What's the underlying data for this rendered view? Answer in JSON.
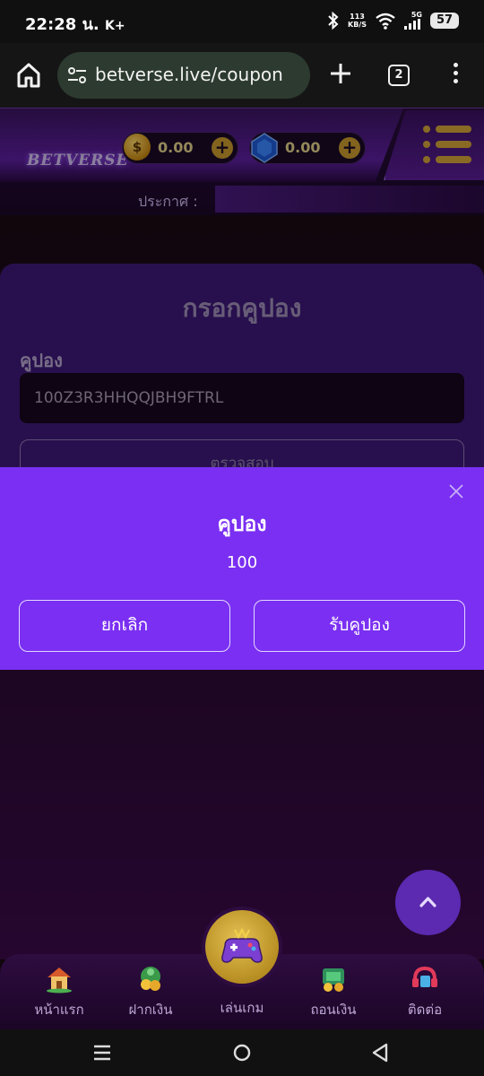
{
  "status_bar": {
    "time": "22:28 น.",
    "carrier_icon": "K+",
    "net_speed_value": "113",
    "net_speed_unit": "KB/S",
    "network": "5G",
    "battery": "57"
  },
  "browser": {
    "url": "betverse.live/coupon",
    "tab_count": "2"
  },
  "site_header": {
    "logo_text": "BETVERSE",
    "coin_balance": "0.00",
    "gem_balance": "0.00",
    "announcement_label": "ประกาศ :"
  },
  "coupon_form": {
    "title": "กรอกคูปอง",
    "field_label": "คูปอง",
    "field_value": "100Z3R3HHQQJBH9FTRL",
    "check_button": "ตรวจสอบ"
  },
  "modal": {
    "title": "คูปอง",
    "value": "100",
    "cancel_button": "ยกเลิก",
    "claim_button": "รับคูปอง"
  },
  "bottom_nav": {
    "items": [
      {
        "label": "หน้าแรก",
        "icon": "house-icon"
      },
      {
        "label": "ฝากเงิน",
        "icon": "deposit-icon"
      },
      {
        "label": "เล่นเกม",
        "icon": "gamepad-icon"
      },
      {
        "label": "ถอนเงิน",
        "icon": "withdraw-icon"
      },
      {
        "label": "ติดต่อ",
        "icon": "contact-icon"
      }
    ]
  },
  "colors": {
    "modal_bg": "#7a2ff2",
    "accent_gold": "#d3a33a",
    "card_bg": "#3e1a78"
  }
}
